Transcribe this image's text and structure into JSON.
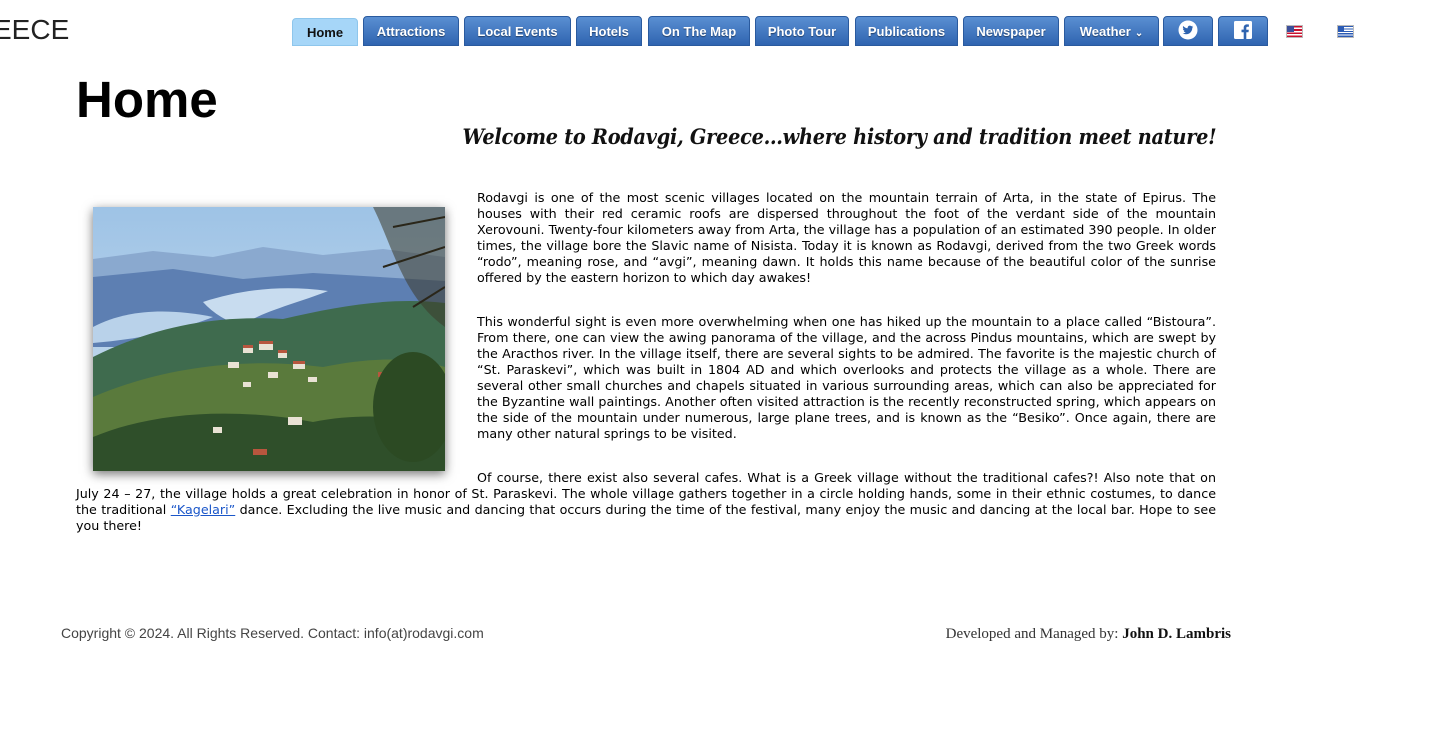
{
  "header": {
    "site_name": "EECE"
  },
  "nav": {
    "items": [
      {
        "label": "Home",
        "active": true
      },
      {
        "label": "Attractions"
      },
      {
        "label": "Local Events"
      },
      {
        "label": "Hotels"
      },
      {
        "label": "On The Map"
      },
      {
        "label": "Photo Tour"
      },
      {
        "label": "Publications"
      },
      {
        "label": "Newspaper"
      },
      {
        "label": "Weather",
        "dropdown": true
      }
    ],
    "social": [
      "twitter-icon",
      "facebook-icon"
    ],
    "languages": [
      "us-flag-icon",
      "greek-flag-icon"
    ]
  },
  "main": {
    "title": "Home",
    "tagline": "Welcome to Rodavgi, Greece…where history and tradition meet nature!",
    "paragraphs": [
      "Rodavgi is one of the most scenic villages located on the mountain terrain of Arta, in the state of Epirus. The houses with their red ceramic roofs are dispersed throughout the foot of the verdant side of the mountain Xerovouni. Twenty-four kilometers away from Arta, the village has a population of an estimated 390 people. In older times, the village bore the Slavic name of Nisista. Today it is known as Rodavgi, derived from the two Greek words “rodo”, meaning rose, and “avgi”, meaning dawn. It holds this name because of the beautiful color of the sunrise offered by the eastern horizon to which day awakes!",
      "This wonderful sight is even more overwhelming when one has hiked up the mountain to a place called “Bistoura”. From there, one can view the awing panorama of the village, and the across Pindus mountains, which are swept by the Aracthos river. In the village itself, there are several sights to be admired. The favorite is the majestic church of “St. Paraskevi”, which was built in 1804 AD and which overlooks and protects the village as a whole. There are several other small churches and chapels situated in various surrounding areas, which can also be appreciated for the Byzantine wall paintings. Another often visited attraction is the recently reconstructed spring, which appears on the side of the mountain under numerous, large plane trees, and is known as the “Besiko”. Once again, there are many other natural springs to be visited."
    ],
    "p3_before": "Of course, there exist also several cafes. What is a Greek village without the traditional cafes?! Also note that on July 24 – 27, the village holds a great celebration in honor of St. Paraskevi. The whole village gathers together in a circle holding hands, some in their ethnic costumes, to dance the traditional ",
    "p3_link": "“Kagelari”",
    "p3_after": " dance. Excluding the live music and dancing that occurs during the time of the festival, many enjoy the music and dancing at the local bar. Hope to see you there!"
  },
  "footer": {
    "copyright": "Copyright © 2024. All Rights Reserved. Contact: info(at)rodavgi.com",
    "developed_label": "Developed and Managed by:",
    "developer": "John D. Lambris"
  }
}
